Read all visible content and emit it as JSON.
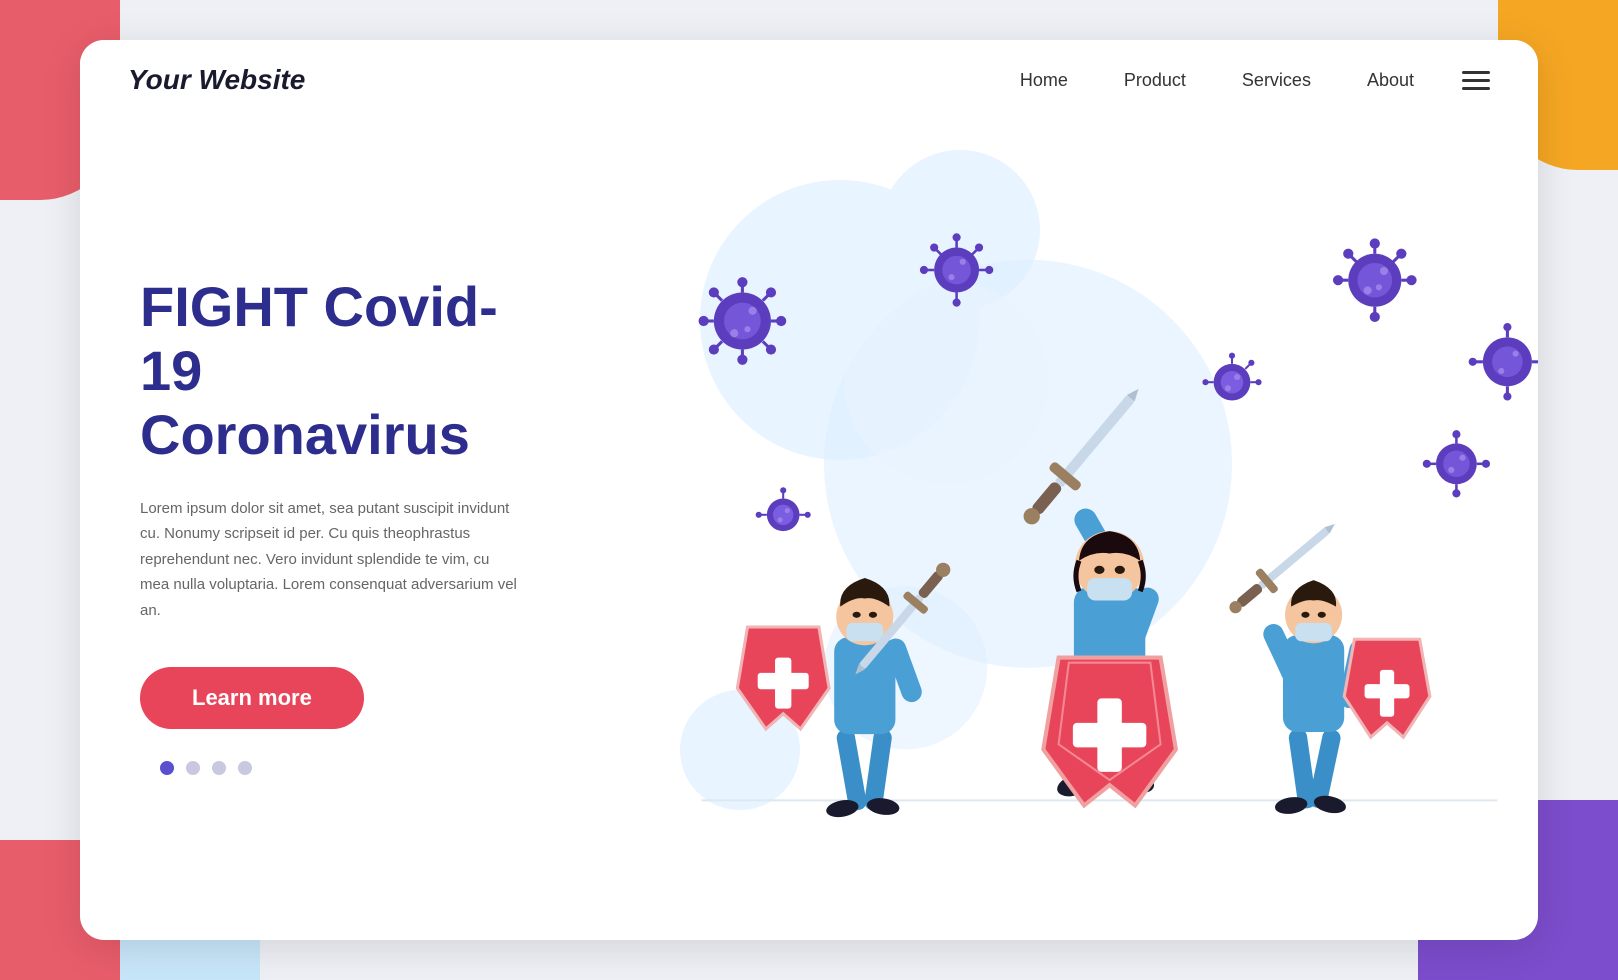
{
  "logo": "Your Website",
  "navbar": {
    "links": [
      {
        "label": "Home",
        "name": "home"
      },
      {
        "label": "Product",
        "name": "product"
      },
      {
        "label": "Services",
        "name": "services"
      },
      {
        "label": "About",
        "name": "about"
      }
    ]
  },
  "hero": {
    "title_line1": "FIGHT Covid-19",
    "title_line2": "Coronavirus",
    "description": "Lorem ipsum dolor sit amet, sea putant suscipit invidunt cu. Nonumy scripseit id per. Cu quis theophrastus reprehendunt nec. Vero invidunt splendide te vim, cu mea nulla voluptaria. Lorem consenquat adversarium vel an.",
    "cta_label": "Learn more",
    "dots": [
      {
        "active": true
      },
      {
        "active": false
      },
      {
        "active": false
      },
      {
        "active": false
      }
    ]
  },
  "colors": {
    "accent": "#e8455a",
    "navy": "#2d2d8e",
    "blue_figure": "#4a9fd4",
    "shield_red": "#e8455a",
    "virus_blue": "#5b3dbd",
    "bg_circle": "#ddeeff"
  }
}
